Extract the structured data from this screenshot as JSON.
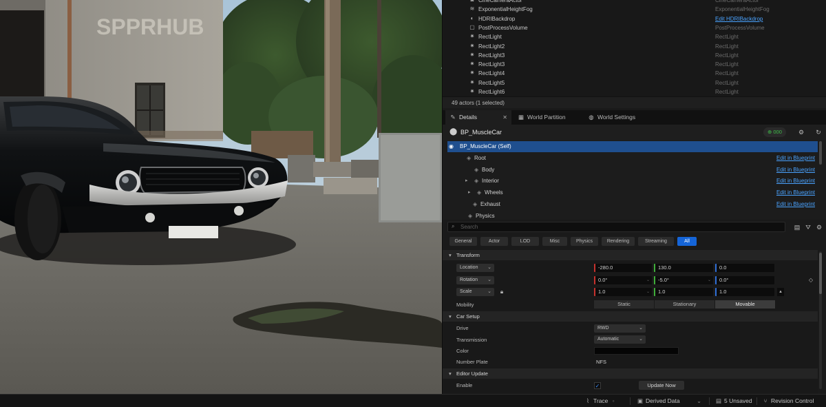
{
  "outliner": {
    "rows": [
      {
        "name": "CineCameraActor",
        "type": "CineCameraActor",
        "icon": "camera-icon",
        "link": false
      },
      {
        "name": "ExponentialHeightFog",
        "type": "ExponentialHeightFog",
        "icon": "fog-icon",
        "link": false
      },
      {
        "name": "HDRIBackdrop",
        "type": "Edit HDRIBackdrop",
        "icon": "backdrop-icon",
        "link": true
      },
      {
        "name": "PostProcessVolume",
        "type": "PostProcessVolume",
        "icon": "volume-icon",
        "link": false
      },
      {
        "name": "RectLight",
        "type": "RectLight",
        "icon": "light-icon",
        "link": false
      },
      {
        "name": "RectLight2",
        "type": "RectLight",
        "icon": "light-icon",
        "link": false
      },
      {
        "name": "RectLight3",
        "type": "RectLight",
        "icon": "light-icon",
        "link": false
      },
      {
        "name": "RectLight3",
        "type": "RectLight",
        "icon": "light-icon",
        "link": false
      },
      {
        "name": "RectLight4",
        "type": "RectLight",
        "icon": "light-icon",
        "link": false
      },
      {
        "name": "RectLight5",
        "type": "RectLight",
        "icon": "light-icon",
        "link": false
      },
      {
        "name": "RectLight6",
        "type": "RectLight",
        "icon": "light-icon",
        "link": false
      }
    ],
    "actor_count": "49 actors (1 selected)"
  },
  "tabs": [
    {
      "label": "Details",
      "icon": "details-icon",
      "close": "✕"
    },
    {
      "label": "World Partition",
      "icon": "grid-icon"
    },
    {
      "label": "World Settings",
      "icon": "globe-icon"
    }
  ],
  "details": {
    "actor_name": "BP_MuscleCar",
    "add_label": "⊕ 000"
  },
  "components": [
    {
      "name": "BP_MuscleCar (Self)",
      "link": "",
      "selected": true
    },
    {
      "name": "Root",
      "link": "Edit in Blueprint"
    },
    {
      "name": "Body",
      "link": "Edit in Blueprint"
    },
    {
      "name": "Interior",
      "link": "Edit in Blueprint"
    },
    {
      "name": "Wheels",
      "link": "Edit in Blueprint"
    },
    {
      "name": "Exhaust",
      "link": "Edit in Blueprint"
    },
    {
      "name": "Physics",
      "link": ""
    }
  ],
  "search": {
    "placeholder": "Search"
  },
  "filters": [
    "General",
    "Actor",
    "LOD",
    "Misc",
    "Physics",
    "Rendering",
    "Streaming",
    "All"
  ],
  "active_filter": "All",
  "transform": {
    "section": "Transform",
    "location": {
      "label": "Location",
      "x": "-280.0",
      "y": "130.0",
      "z": "0.0"
    },
    "rotation": {
      "label": "Rotation",
      "x": "0.0°",
      "y": "-5.0°",
      "z": "0.0°"
    },
    "scale": {
      "label": "Scale",
      "x": "1.0",
      "y": "1.0",
      "z": "1.0"
    },
    "mobility": {
      "label": "Mobility",
      "options": [
        "Static",
        "Stationary",
        "Movable"
      ],
      "selected": "Movable"
    }
  },
  "car_setup": {
    "section": "Car Setup",
    "drive": {
      "label": "Drive",
      "value": "RWD"
    },
    "transmission": {
      "label": "Transmission",
      "value": "Automatic"
    },
    "color": {
      "label": "Color",
      "value": "#050505"
    },
    "number_plate": {
      "label": "Number Plate",
      "value": "NFS"
    }
  },
  "editor_update": {
    "section": "Editor Update",
    "enable": {
      "label": "Enable",
      "checked": true
    },
    "button": "Update Now"
  },
  "statusbar": {
    "trace": "Trace",
    "derived": "Derived Data",
    "unsaved": "5 Unsaved",
    "revision": "Revision Control"
  },
  "viewport": {
    "wall_text": "SPPRHUB"
  },
  "colors": {
    "accent": "#1565d8",
    "link": "#4aa3ff",
    "selection": "#1f4f8f",
    "axis_x": "#c8322e",
    "axis_y": "#3fae3a",
    "axis_z": "#2f6fd8"
  }
}
